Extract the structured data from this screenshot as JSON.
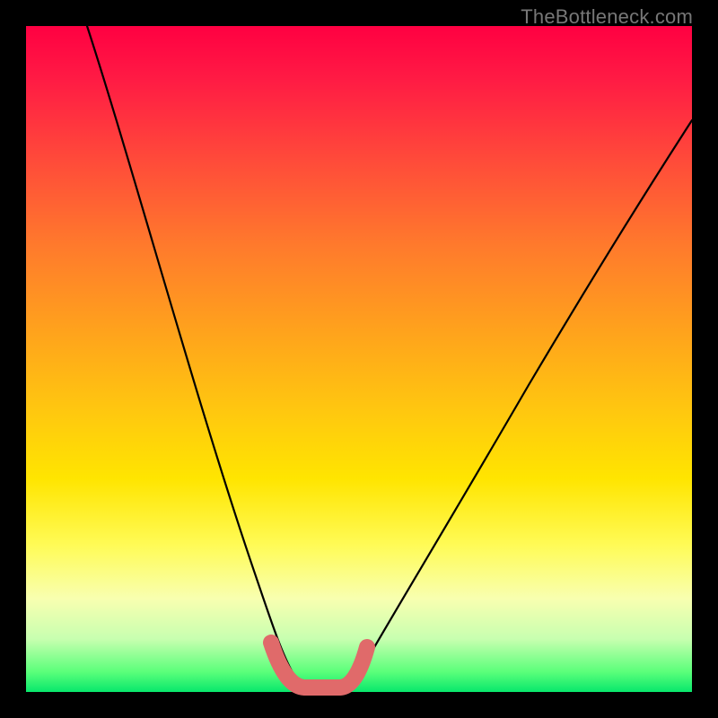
{
  "watermark": "TheBottleneck.com",
  "chart_data": {
    "type": "line",
    "title": "",
    "xlabel": "",
    "ylabel": "",
    "xlim": [
      0,
      1
    ],
    "ylim": [
      0,
      1
    ],
    "series": [
      {
        "name": "bottleneck-curve",
        "x": [
          0.0,
          0.05,
          0.1,
          0.15,
          0.2,
          0.25,
          0.3,
          0.35,
          0.375,
          0.4,
          0.425,
          0.45,
          0.475,
          0.5,
          0.55,
          0.6,
          0.65,
          0.7,
          0.75,
          0.8,
          0.85,
          0.9,
          0.95,
          1.0
        ],
        "y": [
          1.0,
          0.87,
          0.74,
          0.62,
          0.5,
          0.38,
          0.26,
          0.13,
          0.06,
          0.02,
          0.0,
          0.0,
          0.0,
          0.02,
          0.07,
          0.13,
          0.2,
          0.27,
          0.34,
          0.41,
          0.48,
          0.55,
          0.62,
          0.7
        ]
      },
      {
        "name": "valley-marker",
        "x": [
          0.365,
          0.39,
          0.42,
          0.47,
          0.5
        ],
        "y": [
          0.065,
          0.015,
          0.0,
          0.015,
          0.06
        ]
      }
    ],
    "colors": {
      "curve": "#000000",
      "valley_marker": "#e36a6a",
      "gradient_top": "#ff0042",
      "gradient_bottom": "#08e76c"
    }
  }
}
